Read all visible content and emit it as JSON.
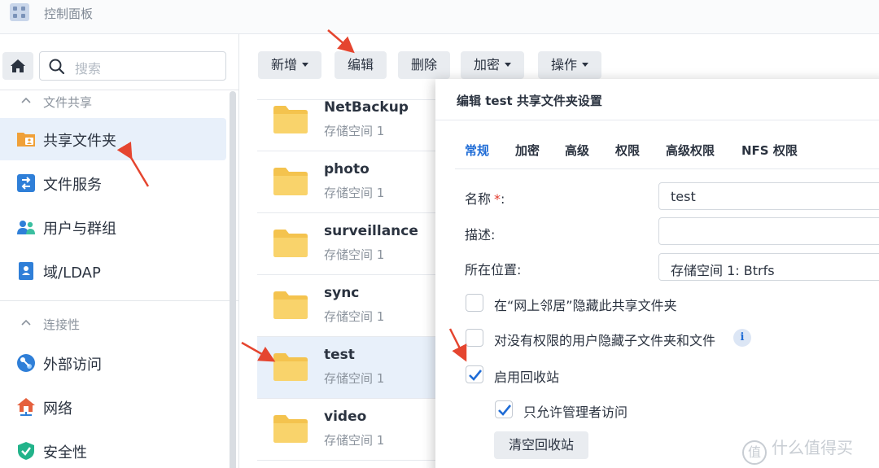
{
  "window": {
    "title": "控制面板"
  },
  "search": {
    "placeholder": "搜索"
  },
  "sidebar": {
    "section_file_sharing": "文件共享",
    "section_connectivity": "连接性",
    "items": [
      {
        "label": "共享文件夹",
        "icon": "shared-folder-icon"
      },
      {
        "label": "文件服务",
        "icon": "file-services-icon"
      },
      {
        "label": "用户与群组",
        "icon": "user-group-icon"
      },
      {
        "label": "域/LDAP",
        "icon": "domain-ldap-icon"
      },
      {
        "label": "外部访问",
        "icon": "external-access-icon"
      },
      {
        "label": "网络",
        "icon": "network-icon"
      },
      {
        "label": "安全性",
        "icon": "security-shield-icon"
      }
    ]
  },
  "toolbar": {
    "create": "新增",
    "edit": "编辑",
    "delete": "删除",
    "encrypt": "加密",
    "action": "操作"
  },
  "folders": [
    {
      "name": "NetBackup",
      "volume": "存储空间 1"
    },
    {
      "name": "photo",
      "volume": "存储空间 1"
    },
    {
      "name": "surveillance",
      "volume": "存储空间 1"
    },
    {
      "name": "sync",
      "volume": "存储空间 1"
    },
    {
      "name": "test",
      "volume": "存储空间 1",
      "selected": true
    },
    {
      "name": "video",
      "volume": "存储空间 1"
    }
  ],
  "dialog": {
    "title": "编辑 test 共享文件夹设置",
    "tabs": [
      "常规",
      "加密",
      "高级",
      "权限",
      "高级权限",
      "NFS 权限"
    ],
    "active_tab": "常规",
    "name_label": "名称",
    "required_mark": "*",
    "name_colon": ":",
    "name_value": "test",
    "desc_label": "描述:",
    "desc_value": "",
    "location_label": "所在位置:",
    "location_value": "存储空间 1:   Btrfs",
    "opt_hide_network": {
      "label": "在“网上邻居”隐藏此共享文件夹",
      "checked": false
    },
    "opt_hide_subfolders": {
      "label": "对没有权限的用户隐藏子文件夹和文件",
      "checked": false
    },
    "opt_recycle_bin": {
      "label": "启用回收站",
      "checked": true
    },
    "opt_admin_only": {
      "label": "只允许管理者访问",
      "checked": true
    },
    "info_glyph": "i",
    "empty_recycle_bin": "清空回收站"
  },
  "colors": {
    "accent": "#1f6cd6",
    "folder": "#f9d36b",
    "arrow": "#e5452f",
    "selection": "#e8f0fa"
  },
  "watermark": {
    "logo": "值",
    "text": "什么值得买"
  }
}
